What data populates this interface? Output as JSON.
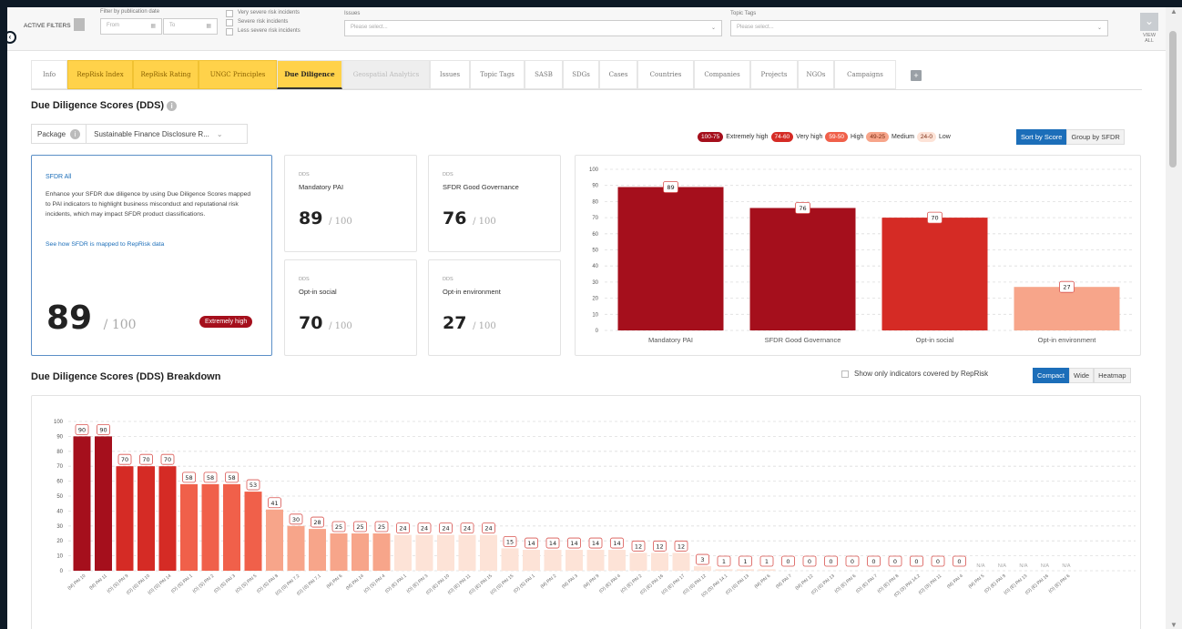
{
  "filters": {
    "active_label": "ACTIVE FILTERS",
    "date_label": "Filter by publication date",
    "from_placeholder": "From",
    "to_placeholder": "To",
    "risk_options": [
      "Very severe risk incidents",
      "Severe risk incidents",
      "Less severe risk incidents"
    ],
    "issues_label": "Issues",
    "issues_placeholder": "Please select...",
    "topic_label": "Topic Tags",
    "topic_placeholder": "Please select...",
    "view_all": [
      "VIEW",
      "ALL"
    ]
  },
  "tabs": [
    "Info",
    "RepRisk Index",
    "RepRisk Rating",
    "UNGC Principles",
    "Due Diligence",
    "Geospatial Analytics",
    "Issues",
    "Topic Tags",
    "SASB",
    "SDGs",
    "Cases",
    "Countries",
    "Companies",
    "Projects",
    "NGOs",
    "Campaigns"
  ],
  "tab_add": "+",
  "dds": {
    "title": "Due Diligence Scores (DDS)",
    "package_label": "Package",
    "package_value": "Sustainable Finance Disclosure R...",
    "legend": [
      {
        "range": "100-75",
        "label": "Extremely high",
        "color": "#a50f1c"
      },
      {
        "range": "74-60",
        "label": "Very high",
        "color": "#d52b25"
      },
      {
        "range": "59-50",
        "label": "High",
        "color": "#f0604a"
      },
      {
        "range": "49-25",
        "label": "Medium",
        "color": "#f7a58a"
      },
      {
        "range": "24-0",
        "label": "Low",
        "color": "#fde3d7"
      }
    ],
    "sort_label": "Sort by Score",
    "group_label": "Group by SFDR",
    "sfdr": {
      "title": "SFDR All",
      "description": "Enhance your SFDR due diligence by using Due Diligence Scores mapped to PAI indicators to highlight business misconduct and reputational risk incidents, which may impact SFDR product classifications.",
      "link": "See how SFDR is mapped to RepRisk data",
      "score": "89",
      "out_of": "/ 100",
      "badge": "Extremely high"
    },
    "cards": [
      {
        "sub": "DDS",
        "name": "Mandatory PAI",
        "score": "89",
        "out_of": "/ 100"
      },
      {
        "sub": "DDS",
        "name": "SFDR Good Governance",
        "score": "76",
        "out_of": "/ 100"
      },
      {
        "sub": "DDS",
        "name": "Opt-in social",
        "score": "70",
        "out_of": "/ 100"
      },
      {
        "sub": "DDS",
        "name": "Opt-in environment",
        "score": "27",
        "out_of": "/ 100"
      }
    ]
  },
  "breakdown": {
    "title": "Due Diligence Scores (DDS) Breakdown",
    "show_only_label": "Show only indicators covered by RepRisk",
    "view_buttons": [
      "Compact",
      "Wide",
      "Heatmap"
    ]
  },
  "chart_data": [
    {
      "type": "bar",
      "categories": [
        "Mandatory PAI",
        "SFDR Good Governance",
        "Opt-in social",
        "Opt-in environment"
      ],
      "values": [
        89,
        76,
        70,
        27
      ],
      "colors": [
        "#a50f1c",
        "#a50f1c",
        "#d52b25",
        "#f7a58a"
      ],
      "ylim": [
        0,
        100
      ],
      "yticks": [
        0,
        10,
        20,
        30,
        40,
        50,
        60,
        70,
        80,
        90,
        100
      ],
      "grid": true
    },
    {
      "type": "bar",
      "categories": [
        "(M) PAI 10",
        "(M) PAI 11",
        "(O) (S) PAI 9",
        "(O) (S) PAI 10",
        "(O) (S) PAI 14",
        "(O) (S) PAI 1",
        "(O) (S) PAI 2",
        "(O) (S) PAI 3",
        "(O) (S) PAI 5",
        "(O) (S) PAI 8",
        "(O) (S) PAI 7.2",
        "(O) (S) PAI 7.1",
        "(M) PAI 6",
        "(M) PAI 14",
        "(O) (S) PAI 4",
        "(O) (E) PAI 1",
        "(O) (E) PAI 3",
        "(O) (E) PAI 10",
        "(O) (E) PAI 11",
        "(O) (E) PAI 15",
        "(O) (S) PAI 15",
        "(O) (S) PAI 1",
        "(M) PAI 2",
        "(M) PAI 3",
        "(M) PAI 9",
        "(O) (E) PAI 4",
        "(O) (E) PAI 2",
        "(O) (E) PAI 16",
        "(O) (E) PAI 17",
        "(O) (S) PAI 12",
        "(O) (S) PAI 14.1",
        "(O) (S) PAI 13",
        "(M) PAI 6",
        "(M) PAI 7",
        "(M) PAI 12",
        "(O) (S) PAI 13",
        "(O) (E) PAI 6",
        "(O) (E) PAI 7",
        "(O) (E) PAI 8",
        "(O) (S) PAI 14.2",
        "(O) (S) PAI 11",
        "(M) PAI 4",
        "(M) PAI 5",
        "(O) (E) PAI 9",
        "(O) (E) PAI 13",
        "(O) (E) PAI 16",
        "(O) (E) PAI 6"
      ],
      "values": [
        90,
        90,
        70,
        70,
        70,
        58,
        58,
        58,
        53,
        41,
        30,
        28,
        25,
        25,
        25,
        24,
        24,
        24,
        24,
        24,
        15,
        14,
        14,
        14,
        14,
        14,
        12,
        12,
        12,
        3,
        1,
        1,
        1,
        0,
        0,
        0,
        0,
        0,
        0,
        0,
        0,
        0,
        null,
        null,
        null,
        null,
        null
      ],
      "labels": [
        "90",
        "90",
        "70",
        "70",
        "70",
        "58",
        "58",
        "58",
        "53",
        "41",
        "30",
        "28",
        "25",
        "25",
        "25",
        "24",
        "24",
        "24",
        "24",
        "24",
        "15",
        "14",
        "14",
        "14",
        "14",
        "14",
        "12",
        "12",
        "12",
        "3",
        "1",
        "1",
        "1",
        "0",
        "0",
        "0",
        "0",
        "0",
        "0",
        "0",
        "0",
        "0",
        "N/A",
        "N/A",
        "N/A",
        "N/A",
        "N/A"
      ],
      "ylim": [
        0,
        100
      ],
      "yticks": [
        0,
        10,
        20,
        30,
        40,
        50,
        60,
        70,
        80,
        90,
        100
      ],
      "grid": true
    }
  ]
}
